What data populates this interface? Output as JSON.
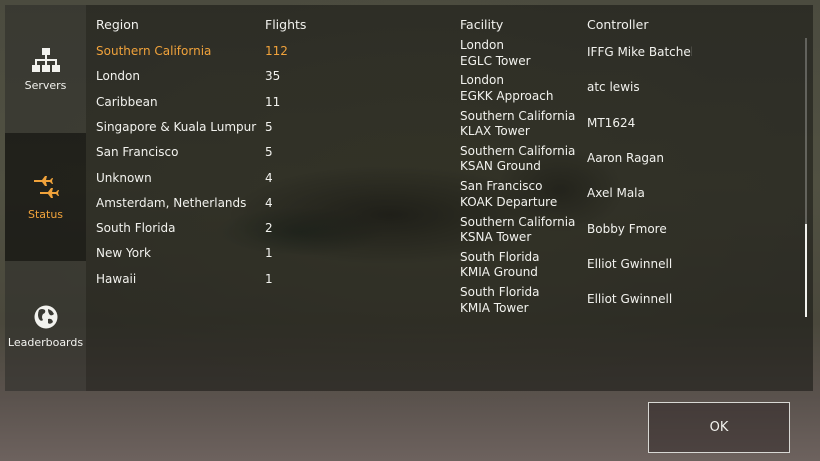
{
  "sidebar": {
    "items": [
      {
        "label": "Servers",
        "icon": "servers-network-icon"
      },
      {
        "label": "Status",
        "icon": "airplanes-icon",
        "active": true
      },
      {
        "label": "Leaderboards",
        "icon": "globe-icon"
      }
    ]
  },
  "colors": {
    "accent": "#f0a23b",
    "text": "#f2f2ee"
  },
  "regions": {
    "header_region": "Region",
    "header_flights": "Flights",
    "rows": [
      {
        "region": "Southern California",
        "flights": "112"
      },
      {
        "region": "London",
        "flights": "35"
      },
      {
        "region": "Caribbean",
        "flights": "11"
      },
      {
        "region": "Singapore & Kuala Lumpur",
        "flights": "5"
      },
      {
        "region": "San Francisco",
        "flights": "5"
      },
      {
        "region": "Unknown",
        "flights": "4"
      },
      {
        "region": "Amsterdam, Netherlands",
        "flights": "4"
      },
      {
        "region": "South Florida",
        "flights": "2"
      },
      {
        "region": "New York",
        "flights": "1"
      },
      {
        "region": "Hawaii",
        "flights": "1"
      }
    ]
  },
  "atc": {
    "header_facility": "Facility",
    "header_controller": "Controller",
    "rows": [
      {
        "region": "London",
        "facility": "EGLC Tower",
        "controller": "IFFG Mike Batchelo"
      },
      {
        "region": "London",
        "facility": "EGKK Approach",
        "controller": "atc lewis"
      },
      {
        "region": "Southern California",
        "facility": "KLAX Tower",
        "controller": "MT1624"
      },
      {
        "region": "Southern California",
        "facility": "KSAN Ground",
        "controller": "Aaron Ragan"
      },
      {
        "region": "San Francisco",
        "facility": "KOAK Departure",
        "controller": "Axel Mala"
      },
      {
        "region": "Southern California",
        "facility": "KSNA Tower",
        "controller": "Bobby Fmore"
      },
      {
        "region": "South Florida",
        "facility": "KMIA Ground",
        "controller": "Elliot Gwinnell"
      },
      {
        "region": "South Florida",
        "facility": "KMIA Tower",
        "controller": "Elliot Gwinnell"
      }
    ]
  },
  "ok_label": "OK"
}
